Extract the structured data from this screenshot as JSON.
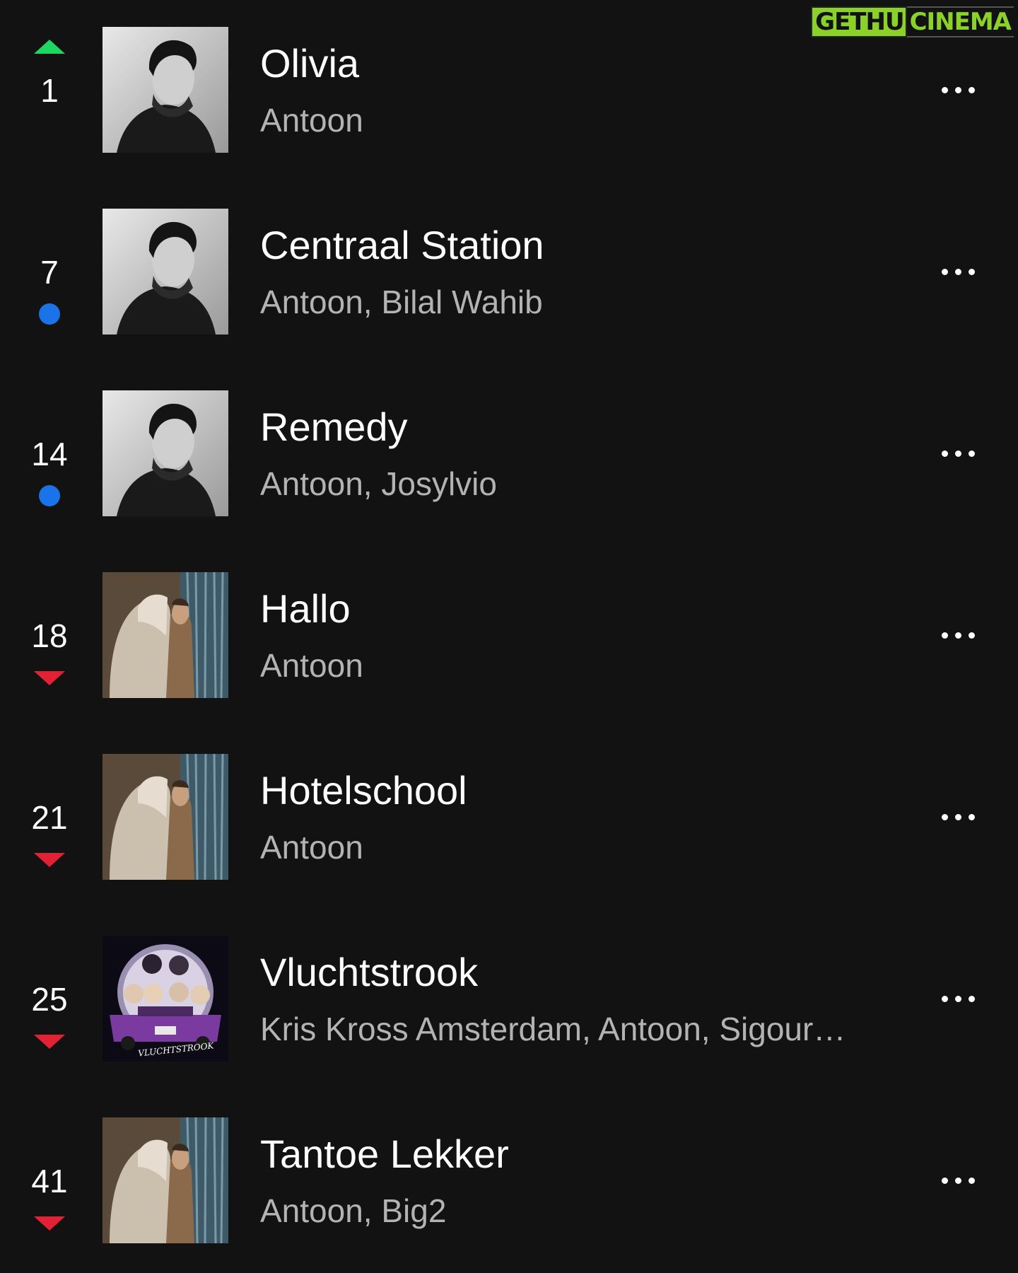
{
  "watermark": {
    "part1": "GETHU",
    "part2": "CINEMA"
  },
  "colors": {
    "background": "#121212",
    "up": "#1ed760",
    "down": "#e22134",
    "new": "#1a73e8",
    "subtext": "#b3b3b3"
  },
  "tracks": [
    {
      "rank": "1",
      "indicator": "up",
      "title": "Olivia",
      "artists": "Antoon",
      "cover": "portrait-bw",
      "more_icon": "more-horizontal-icon"
    },
    {
      "rank": "7",
      "indicator": "new",
      "title": "Centraal Station",
      "artists": "Antoon, Bilal Wahib",
      "cover": "portrait-bw",
      "more_icon": "more-horizontal-icon"
    },
    {
      "rank": "14",
      "indicator": "new",
      "title": "Remedy",
      "artists": "Antoon, Josylvio",
      "cover": "portrait-bw",
      "more_icon": "more-horizontal-icon"
    },
    {
      "rank": "18",
      "indicator": "down",
      "title": "Hallo",
      "artists": "Antoon",
      "cover": "horse-curtain",
      "more_icon": "more-horizontal-icon"
    },
    {
      "rank": "21",
      "indicator": "down",
      "title": "Hotelschool",
      "artists": "Antoon",
      "cover": "horse-curtain",
      "more_icon": "more-horizontal-icon"
    },
    {
      "rank": "25",
      "indicator": "down",
      "title": "Vluchtstrook",
      "artists": "Kris Kross Amsterdam, Antoon, Sigour…",
      "cover": "vluchtstrook-art",
      "cover_text": "VLUCHTSTROOK",
      "more_icon": "more-horizontal-icon"
    },
    {
      "rank": "41",
      "indicator": "down",
      "title": "Tantoe Lekker",
      "artists": "Antoon, Big2",
      "cover": "horse-curtain",
      "more_icon": "more-horizontal-icon"
    }
  ]
}
